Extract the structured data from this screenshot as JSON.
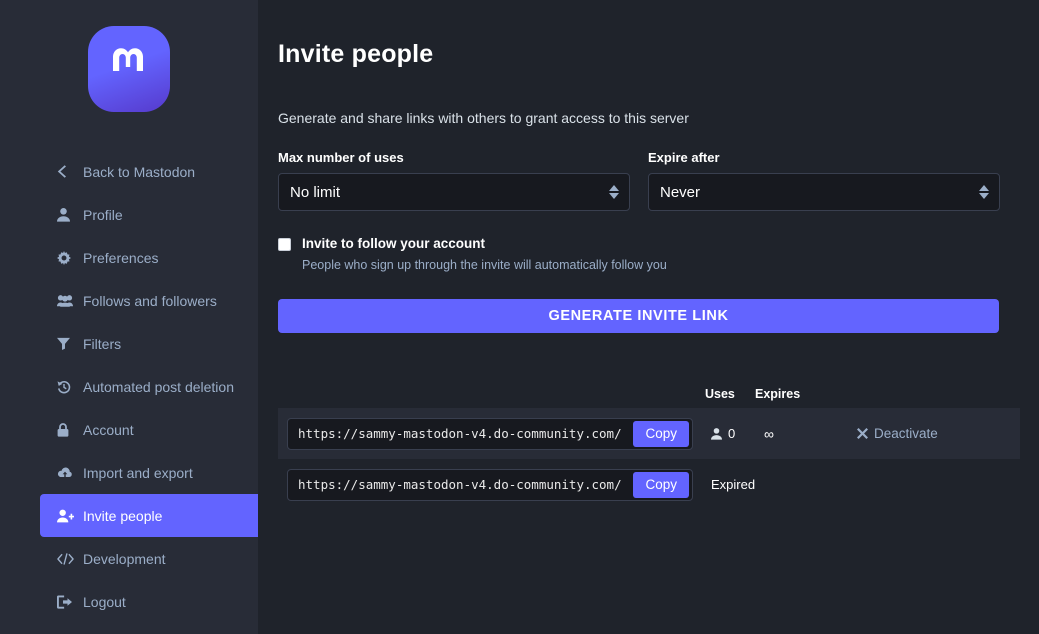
{
  "sidebar": {
    "logo_name": "mastodon-logo",
    "items": [
      {
        "label": "Back to Mastodon",
        "icon": "chevron-left-icon",
        "name": "back-to-mastodon",
        "active": false
      },
      {
        "label": "Profile",
        "icon": "person-icon",
        "name": "profile",
        "active": false
      },
      {
        "label": "Preferences",
        "icon": "gear-icon",
        "name": "preferences",
        "active": false
      },
      {
        "label": "Follows and followers",
        "icon": "users-icon",
        "name": "follows-and-followers",
        "active": false
      },
      {
        "label": "Filters",
        "icon": "filter-icon",
        "name": "filters",
        "active": false
      },
      {
        "label": "Automated post deletion",
        "icon": "history-icon",
        "name": "automated-post-deletion",
        "active": false
      },
      {
        "label": "Account",
        "icon": "lock-icon",
        "name": "account",
        "active": false
      },
      {
        "label": "Import and export",
        "icon": "cloud-upload-icon",
        "name": "import-and-export",
        "active": false
      },
      {
        "label": "Invite people",
        "icon": "user-plus-icon",
        "name": "invite-people",
        "active": true
      },
      {
        "label": "Development",
        "icon": "code-icon",
        "name": "development",
        "active": false
      },
      {
        "label": "Logout",
        "icon": "logout-icon",
        "name": "logout",
        "active": false
      }
    ]
  },
  "main": {
    "title": "Invite people",
    "description": "Generate and share links with others to grant access to this server",
    "fields": {
      "max_uses": {
        "label": "Max number of uses",
        "value": "No limit"
      },
      "expire_after": {
        "label": "Expire after",
        "value": "Never"
      }
    },
    "checkbox": {
      "label": "Invite to follow your account",
      "hint": "People who sign up through the invite will automatically follow you",
      "checked": false
    },
    "generate_button": "GENERATE INVITE LINK",
    "table": {
      "headers": {
        "uses": "Uses",
        "expires": "Expires"
      },
      "rows": [
        {
          "url": "https://sammy-mastodon-v4.do-community.com/",
          "copy_label": "Copy",
          "uses": "0",
          "expires": "∞",
          "action": "Deactivate",
          "status": ""
        },
        {
          "url": "https://sammy-mastodon-v4.do-community.com/",
          "copy_label": "Copy",
          "uses": "",
          "expires": "",
          "action": "",
          "status": "Expired"
        }
      ]
    }
  },
  "colors": {
    "accent": "#6364ff",
    "sidebar_bg": "#282c37",
    "main_bg": "#1f232b",
    "input_bg": "#17191f",
    "muted_text": "#9baec8"
  }
}
